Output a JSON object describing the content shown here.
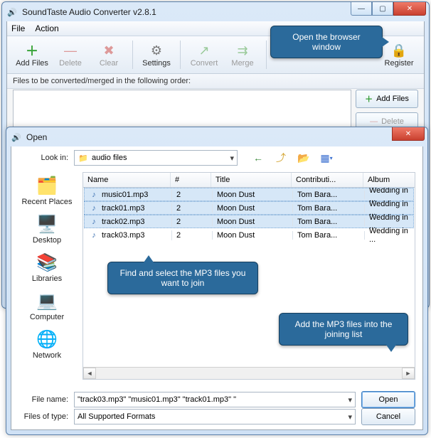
{
  "main": {
    "title": "SoundTaste Audio Converter v2.8.1",
    "menu": {
      "file": "File",
      "action": "Action"
    },
    "toolbar": {
      "add": "Add Files",
      "delete": "Delete",
      "clear": "Clear",
      "settings": "Settings",
      "convert": "Convert",
      "merge": "Merge",
      "register": "Register"
    },
    "subheader": "Files to be converted/merged in the following order:",
    "side": {
      "add": "Add Files",
      "delete": "Delete"
    }
  },
  "tips": {
    "t1": "Open the browser window",
    "t2": "Find and select the MP3 files you want to join",
    "t3": "Add the MP3 files into the joining list"
  },
  "dlg": {
    "title": "Open",
    "lookin_label": "Look in:",
    "lookin_value": "audio files",
    "nav": {
      "back": "back",
      "up": "up",
      "newf": "new-folder",
      "views": "views"
    },
    "places": [
      {
        "name": "Recent Places",
        "icon": "🗂️"
      },
      {
        "name": "Desktop",
        "icon": "🖥️"
      },
      {
        "name": "Libraries",
        "icon": "📚"
      },
      {
        "name": "Computer",
        "icon": "💻"
      },
      {
        "name": "Network",
        "icon": "🌐"
      }
    ],
    "cols": {
      "name": "Name",
      "num": "#",
      "title": "Title",
      "contrib": "Contributi...",
      "album": "Album"
    },
    "rows": [
      {
        "name": "music01.mp3",
        "num": "2",
        "title": "Moon Dust",
        "contrib": "Tom Bara...",
        "album": "Wedding in ...",
        "sel": true
      },
      {
        "name": "track01.mp3",
        "num": "2",
        "title": "Moon Dust",
        "contrib": "Tom Bara...",
        "album": "Wedding in ...",
        "sel": true
      },
      {
        "name": "track02.mp3",
        "num": "2",
        "title": "Moon Dust",
        "contrib": "Tom Bara...",
        "album": "Wedding in ...",
        "sel": true
      },
      {
        "name": "track03.mp3",
        "num": "2",
        "title": "Moon Dust",
        "contrib": "Tom Bara...",
        "album": "Wedding in ...",
        "sel": false
      }
    ],
    "filename_label": "File name:",
    "filename_value": "\"track03.mp3\" \"music01.mp3\" \"track01.mp3\" \"",
    "filetype_label": "Files of type:",
    "filetype_value": "All Supported Formats",
    "open": "Open",
    "cancel": "Cancel"
  }
}
